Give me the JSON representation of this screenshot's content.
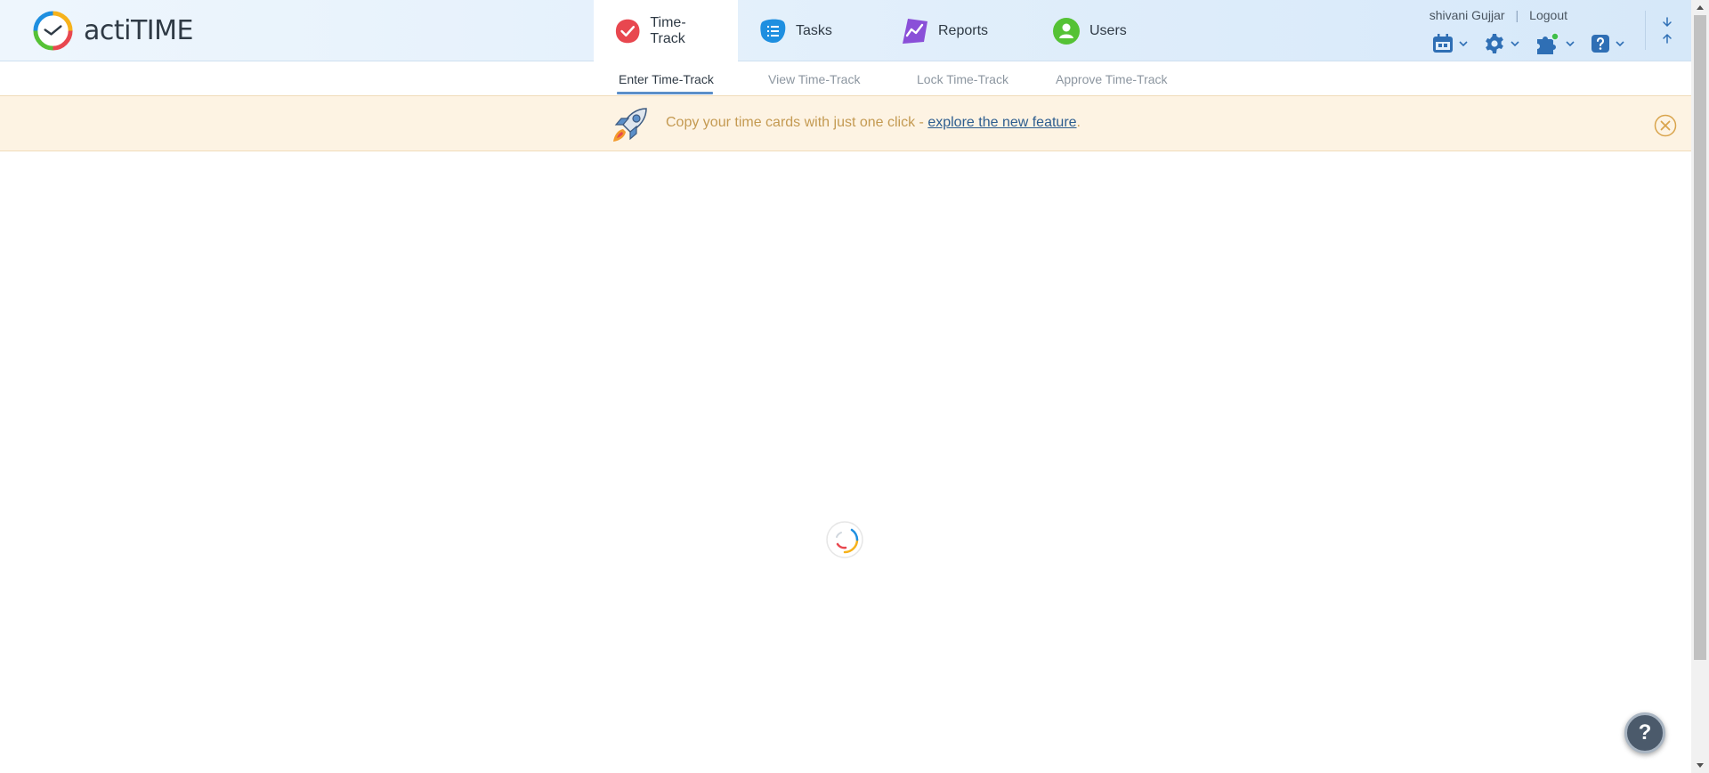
{
  "app": {
    "logo_text": "actiTIME"
  },
  "modules": [
    {
      "label": "Time-Track",
      "icon": "time-track-icon",
      "color": "#e8474f",
      "active": true
    },
    {
      "label": "Tasks",
      "icon": "tasks-icon",
      "color": "#1e8fe0",
      "active": false
    },
    {
      "label": "Reports",
      "icon": "reports-icon",
      "color": "#8a4fd8",
      "active": false
    },
    {
      "label": "Users",
      "icon": "users-icon",
      "color": "#55c235",
      "active": false
    }
  ],
  "user": {
    "name": "shivani Gujjar",
    "separator": "|",
    "logout_label": "Logout"
  },
  "tools": [
    {
      "icon": "calendar-icon"
    },
    {
      "icon": "gear-icon"
    },
    {
      "icon": "puzzle-icon",
      "status_dot_color": "#3fbf4a"
    },
    {
      "icon": "help-icon"
    }
  ],
  "subtabs": [
    {
      "label": "Enter Time-Track",
      "active": true
    },
    {
      "label": "View Time-Track",
      "active": false
    },
    {
      "label": "Lock Time-Track",
      "active": false
    },
    {
      "label": "Approve Time-Track",
      "active": false
    }
  ],
  "banner": {
    "text": "Copy your time cards with just one click - ",
    "link_text": "explore the new feature",
    "trailing": "."
  },
  "help_fab": {
    "label": "?"
  },
  "colors": {
    "accent": "#5b8fc9",
    "banner_bg": "#fdf3e3",
    "banner_text": "#c49a52",
    "link": "#2d5d8f"
  }
}
